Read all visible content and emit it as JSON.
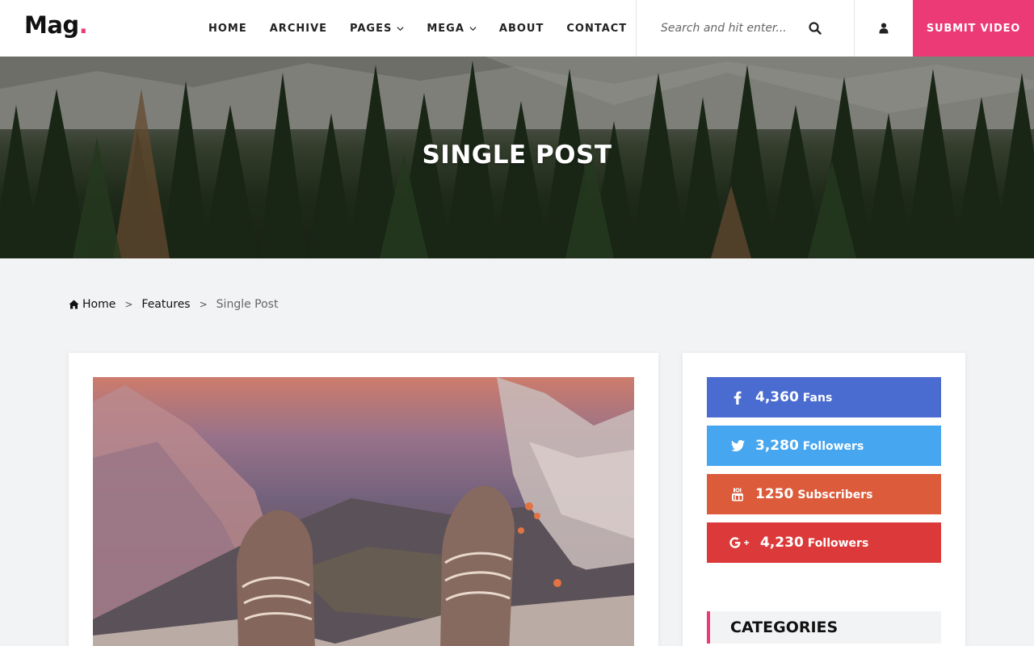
{
  "brand": {
    "logo_text": "Mag",
    "logo_dot": ".",
    "accent": "#ec3a77"
  },
  "nav": {
    "items": [
      {
        "label": "HOME",
        "has_dropdown": false
      },
      {
        "label": "ARCHIVE",
        "has_dropdown": false
      },
      {
        "label": "PAGES",
        "has_dropdown": true
      },
      {
        "label": "MEGA",
        "has_dropdown": true
      },
      {
        "label": "ABOUT",
        "has_dropdown": false
      },
      {
        "label": "CONTACT",
        "has_dropdown": false
      }
    ]
  },
  "search": {
    "placeholder": "Search and hit enter...",
    "value": "",
    "icon": "search-icon"
  },
  "header_actions": {
    "user_icon": "user-icon",
    "submit_label": "SUBMIT VIDEO"
  },
  "hero": {
    "title": "SINGLE POST"
  },
  "breadcrumb": {
    "items": [
      {
        "label": "Home",
        "icon": "home-icon"
      },
      {
        "label": "Features"
      },
      {
        "label": "Single Post"
      }
    ],
    "separator": ">"
  },
  "social": [
    {
      "network": "facebook",
      "icon": "facebook-icon",
      "count": "4,360",
      "label": "Fans",
      "color": "#4a6bd0"
    },
    {
      "network": "twitter",
      "icon": "twitter-icon",
      "count": "3,280",
      "label": "Followers",
      "color": "#47a6f0"
    },
    {
      "network": "youtube",
      "icon": "youtube-icon",
      "count": "1250",
      "label": "Subscribers",
      "color": "#dc5b3a"
    },
    {
      "network": "google-plus",
      "icon": "google-plus-icon",
      "count": "4,230",
      "label": "Followers",
      "color": "#dc3a3a"
    }
  ],
  "sidebar": {
    "categories_title": "CATEGORIES"
  }
}
